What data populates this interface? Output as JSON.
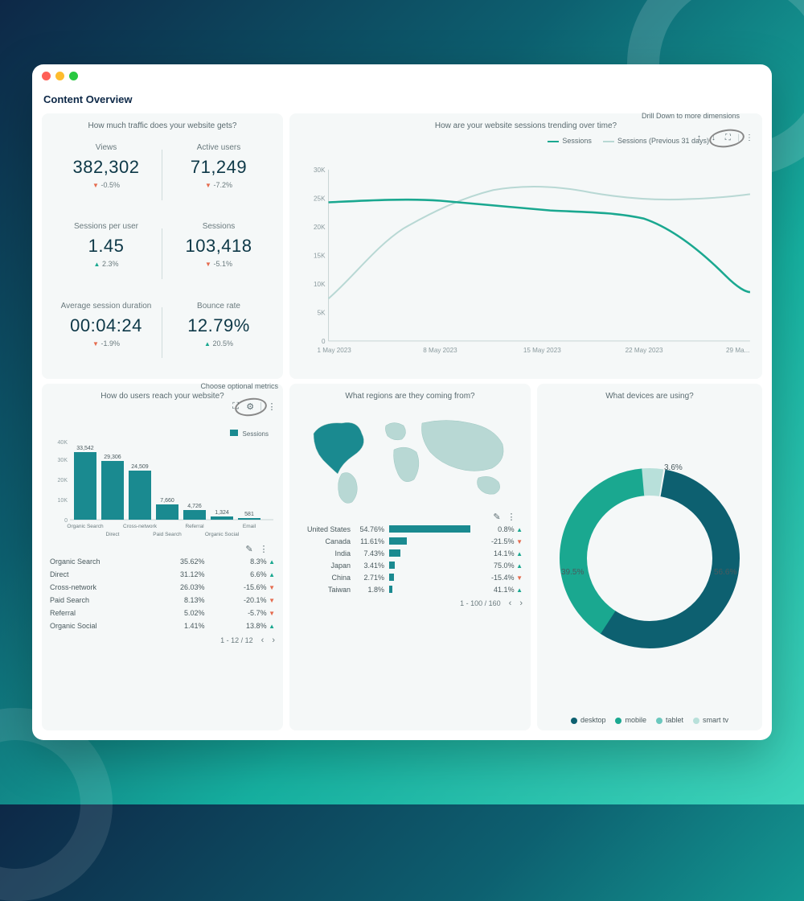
{
  "page_title": "Content Overview",
  "annotations": {
    "drill_down": "Drill Down to more dimensions",
    "choose_metrics": "Choose optional metrics"
  },
  "traffic": {
    "title": "How much traffic does your website gets?",
    "kpis": [
      {
        "label": "Views",
        "value": "382,302",
        "delta": "-0.5%",
        "dir": "down"
      },
      {
        "label": "Active users",
        "value": "71,249",
        "delta": "-7.2%",
        "dir": "down"
      },
      {
        "label": "Sessions per user",
        "value": "1.45",
        "delta": "2.3%",
        "dir": "up"
      },
      {
        "label": "Sessions",
        "value": "103,418",
        "delta": "-5.1%",
        "dir": "down"
      },
      {
        "label": "Average session duration",
        "value": "00:04:24",
        "delta": "-1.9%",
        "dir": "down"
      },
      {
        "label": "Bounce rate",
        "value": "12.79%",
        "delta": "20.5%",
        "dir": "up"
      }
    ]
  },
  "trend": {
    "title": "How are your website sessions trending over time?",
    "legend": [
      "Sessions",
      "Sessions (Previous 31 days)"
    ]
  },
  "reach": {
    "title": "How do users reach your website?",
    "legend": "Sessions",
    "rows": [
      {
        "name": "Organic Search",
        "pct": "35.62%",
        "delta": "8.3%",
        "dir": "up"
      },
      {
        "name": "Direct",
        "pct": "31.12%",
        "delta": "6.6%",
        "dir": "up"
      },
      {
        "name": "Cross-network",
        "pct": "26.03%",
        "delta": "-15.6%",
        "dir": "down"
      },
      {
        "name": "Paid Search",
        "pct": "8.13%",
        "delta": "-20.1%",
        "dir": "down"
      },
      {
        "name": "Referral",
        "pct": "5.02%",
        "delta": "-5.7%",
        "dir": "down"
      },
      {
        "name": "Organic Social",
        "pct": "1.41%",
        "delta": "13.8%",
        "dir": "up"
      }
    ],
    "pager": "1 - 12 / 12"
  },
  "regions": {
    "title": "What regions are they coming from?",
    "rows": [
      {
        "name": "United States",
        "pct": "54.76%",
        "w": 84,
        "delta": "0.8%",
        "dir": "up"
      },
      {
        "name": "Canada",
        "pct": "11.61%",
        "w": 18,
        "delta": "-21.5%",
        "dir": "down"
      },
      {
        "name": "India",
        "pct": "7.43%",
        "w": 12,
        "delta": "14.1%",
        "dir": "up"
      },
      {
        "name": "Japan",
        "pct": "3.41%",
        "w": 6,
        "delta": "75.0%",
        "dir": "up"
      },
      {
        "name": "China",
        "pct": "2.71%",
        "w": 5,
        "delta": "-15.4%",
        "dir": "down"
      },
      {
        "name": "Taiwan",
        "pct": "1.8%",
        "w": 3,
        "delta": "41.1%",
        "dir": "up"
      }
    ],
    "pager": "1 - 100 / 160"
  },
  "devices": {
    "title": "What devices are using?",
    "labels": [
      "desktop",
      "mobile",
      "tablet",
      "smart tv"
    ],
    "slices": [
      {
        "label": "56.6%",
        "color": "#0d6070"
      },
      {
        "label": "39.5%",
        "color": "#1aa890"
      },
      {
        "label": "3.6%",
        "color": "#b8e0da"
      }
    ]
  },
  "chart_data": [
    {
      "type": "line",
      "title": "How are your website sessions trending over time?",
      "x": [
        "1 May 2023",
        "8 May 2023",
        "15 May 2023",
        "22 May 2023",
        "29 Ma..."
      ],
      "ylabel": "",
      "ylim": [
        0,
        30000
      ],
      "y_ticks": [
        0,
        "5K",
        "10K",
        "15K",
        "20K",
        "25K",
        "30K"
      ],
      "series": [
        {
          "name": "Sessions",
          "values": [
            24500,
            24800,
            25200,
            25000,
            24200,
            23800,
            23800,
            23200,
            22800,
            22800,
            22800,
            22600,
            22200,
            21400,
            19800,
            17800,
            15400,
            12800,
            11000,
            10200,
            10000
          ]
        },
        {
          "name": "Sessions (Previous 31 days)",
          "values": [
            7500,
            11000,
            15500,
            19800,
            23000,
            25200,
            26400,
            26900,
            27100,
            27000,
            26600,
            26200,
            25700,
            25300,
            25000,
            24800,
            24600,
            24700,
            24800,
            25000,
            25200
          ]
        }
      ]
    },
    {
      "type": "bar",
      "title": "How do users reach your website?",
      "ylabel": "Sessions",
      "ylim": [
        0,
        40000
      ],
      "y_ticks": [
        0,
        "10K",
        "20K",
        "30K",
        "40K"
      ],
      "categories": [
        "Organic Search",
        "Direct",
        "Cross-network",
        "Paid Search",
        "Referral",
        "Organic Social",
        "Email"
      ],
      "values": [
        33542,
        29306,
        24509,
        7660,
        4726,
        1324,
        581
      ]
    },
    {
      "type": "pie",
      "title": "What devices are using?",
      "series": [
        {
          "name": "desktop",
          "value": 56.6
        },
        {
          "name": "mobile",
          "value": 39.5
        },
        {
          "name": "tablet",
          "value": 3.6
        },
        {
          "name": "smart tv",
          "value": 0.3
        }
      ]
    }
  ]
}
